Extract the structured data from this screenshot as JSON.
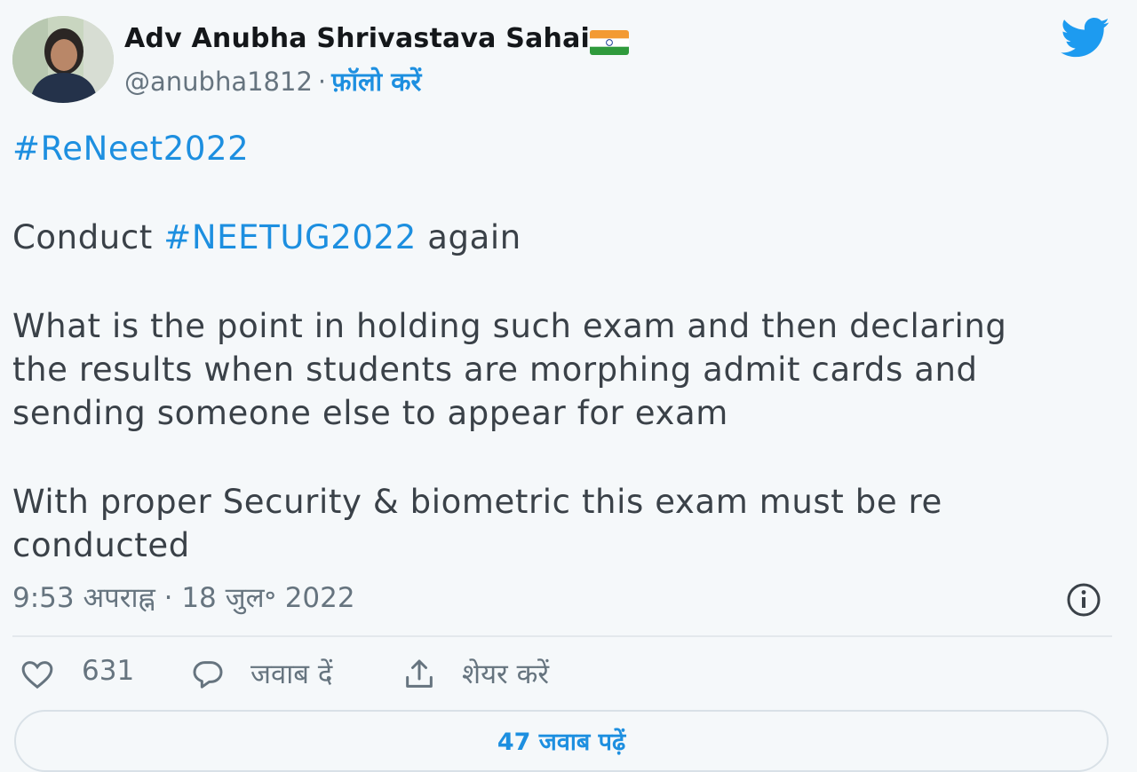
{
  "author": {
    "name": "Adv Anubha Shrivastava Sahai",
    "flag_icon": "india-flag-icon",
    "handle": "@anubha1812",
    "separator": "·",
    "follow_label": "फ़ॉलो करें"
  },
  "brand": {
    "icon": "twitter-bird-icon",
    "color": "#1d9bf0"
  },
  "tweet": {
    "line1": "#ReNeet2022",
    "line2_pre": "Conduct ",
    "line2_tag": "#NEETUG2022",
    "line2_post": " again",
    "line3": "What is the point in holding such exam and then declaring",
    "line4": "the results when students are morphing admit cards and",
    "line5": "sending someone else to appear for exam",
    "line6": "With proper Security & biometric this exam must be re",
    "line7": "conducted"
  },
  "meta": {
    "time": "9:53 अपराह्न",
    "separator": "·",
    "date": "18 जुल॰ 2022",
    "info_icon": "info-icon"
  },
  "actions": {
    "like_icon": "heart-icon",
    "like_count": "631",
    "reply_icon": "reply-bubble-icon",
    "reply_label": "जवाब दें",
    "share_icon": "share-icon",
    "share_label": "शेयर करें"
  },
  "read_replies": {
    "label": "47 जवाब पढ़ें"
  },
  "colors": {
    "link": "#1d8fe0",
    "text": "#3a4148",
    "muted": "#66747f",
    "background": "#f5f8fa"
  }
}
